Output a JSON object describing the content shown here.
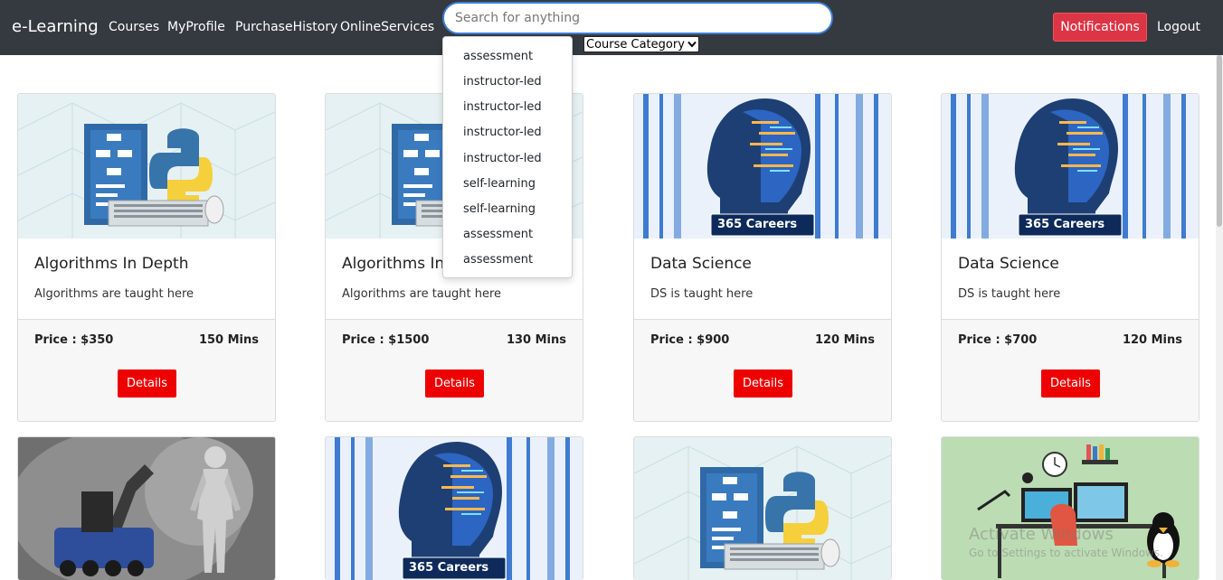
{
  "nav": {
    "brand": "e-Learning",
    "links": [
      "Courses",
      "MyProfile",
      "PurchaseHistory",
      "OnlineServices"
    ],
    "search_placeholder": "Search for anything",
    "category_select": "Course Category",
    "notifications_label": "Notifications",
    "logout_label": "Logout"
  },
  "dropdown": {
    "items": [
      "assessment",
      "instructor-led",
      "instructor-led",
      "instructor-led",
      "instructor-led",
      "self-learning",
      "self-learning",
      "assessment",
      "assessment"
    ]
  },
  "courses": [
    {
      "title": "Algorithms In Depth",
      "description": "Algorithms are taught here",
      "price": "Price : $350",
      "duration": "150 Mins",
      "details_label": "Details"
    },
    {
      "title": "Algorithms In Depth",
      "description": "Algorithms are taught here",
      "price": "Price : $1500",
      "duration": "130 Mins",
      "details_label": "Details"
    },
    {
      "title": "Data Science",
      "description": "DS is taught here",
      "price": "Price : $900",
      "duration": "120 Mins",
      "details_label": "Details"
    },
    {
      "title": "Data Science",
      "description": "DS is taught here",
      "price": "Price : $700",
      "duration": "120 Mins",
      "details_label": "Details"
    }
  ],
  "banner_text": "365 Careers",
  "watermark": {
    "line1": "Activate Windows",
    "line2": "Go to Settings to activate Windows."
  },
  "colors": {
    "navbar": "#343a40",
    "accent_red": "#ee0000",
    "notify_red": "#dc3545",
    "search_border": "#3d7fd6"
  }
}
